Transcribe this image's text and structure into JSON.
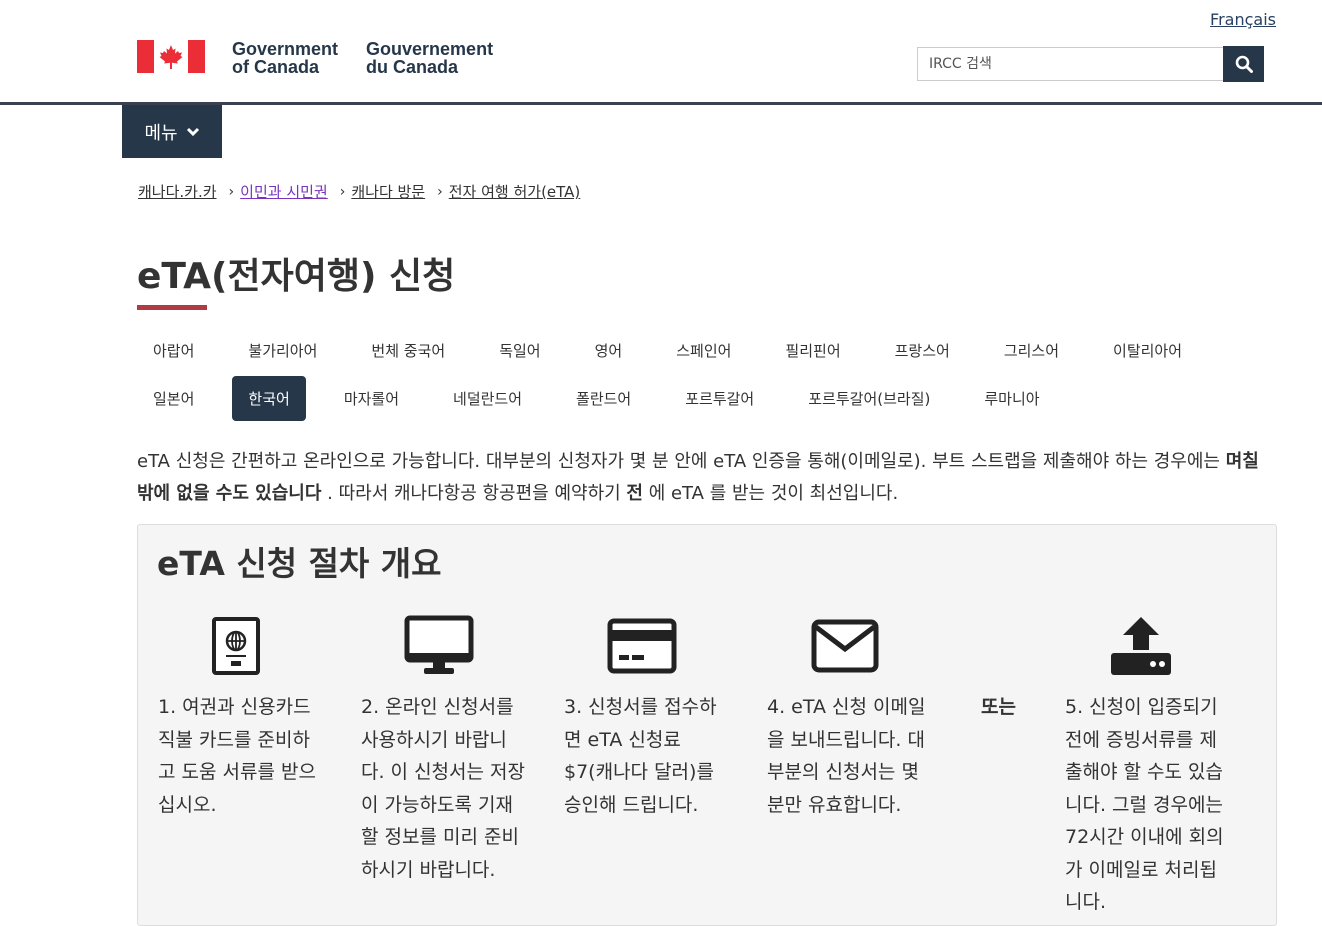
{
  "header": {
    "language_toggle": "Français",
    "brand_en_line1": "Government",
    "brand_en_line2": "of Canada",
    "brand_fr_line1": "Gouvernement",
    "brand_fr_line2": "du Canada",
    "search_placeholder": "IRCC 검색",
    "menu_label": "메뉴"
  },
  "breadcrumb": [
    "캐나다.카.카",
    "이민과 시민권",
    "캐나다 방문",
    "전자 여행 허가(eTA)"
  ],
  "page_title": "eTA(전자여행) 신청",
  "languages": {
    "row1": [
      "아랍어",
      "불가리아어",
      "번체 중국어",
      "독일어",
      "영어",
      "스페인어",
      "필리핀어",
      "프랑스어",
      "그리스어",
      "이탈리아어"
    ],
    "row2": [
      "일본어",
      "한국어",
      "마자롤어",
      "네덜란드어",
      "폴란드어",
      "포르투갈어",
      "포르투갈어(브라질)",
      "루마니아"
    ],
    "active": "한국어"
  },
  "intro": {
    "part1": "eTA 신청은 간편하고 온라인으로 가능합니다. 대부분의 신청자가 몇 분 안에 eTA 인증을 통해(이메일로). 부트 스트랩을 제출해야 하는 경우에는 ",
    "bold1": "며칠 밖에 없을 수도 있습니다",
    "part2": " . 따라서 캐나다항공 항공편을 예약하기 ",
    "bold2": "전",
    "part3": " 에 eTA 를 받는 것이 최선입니다."
  },
  "overview": {
    "title": "eTA 신청 절차 개요",
    "or_label": "또는",
    "steps": [
      {
        "icon": "passport-icon",
        "text": "1. 여권과 신용카드 직불 카드를 준비하고 도움 서류를 받으십시오."
      },
      {
        "icon": "monitor-icon",
        "text": "2. 온라인 신청서를 사용하시기 바랍니다. 이 신청서는 저장이 가능하도록 기재할 정보를 미리 준비하시기 바랍니다."
      },
      {
        "icon": "credit-card-icon",
        "text": "3. 신청서를 접수하면 eTA 신청료 $7(캐나다 달러)를 승인해 드립니다."
      },
      {
        "icon": "envelope-icon",
        "text": "4.  eTA 신청 이메일을 보내드립니다. 대부분의 신청서는 몇 분만 유효합니다."
      },
      {
        "icon": "upload-icon",
        "text": "5. 신청이 입증되기 전에 증빙서류를 제출해야 할 수도 있습니다. 그럴 경우에는 72시간 이내에 회의가 이메일로 처리됩니다."
      }
    ]
  },
  "colors": {
    "navy": "#26374a",
    "flag_red": "#eb2d37",
    "title_underline": "#af3c43",
    "visited_link": "#7834bc",
    "panel_bg": "#f5f5f5"
  }
}
